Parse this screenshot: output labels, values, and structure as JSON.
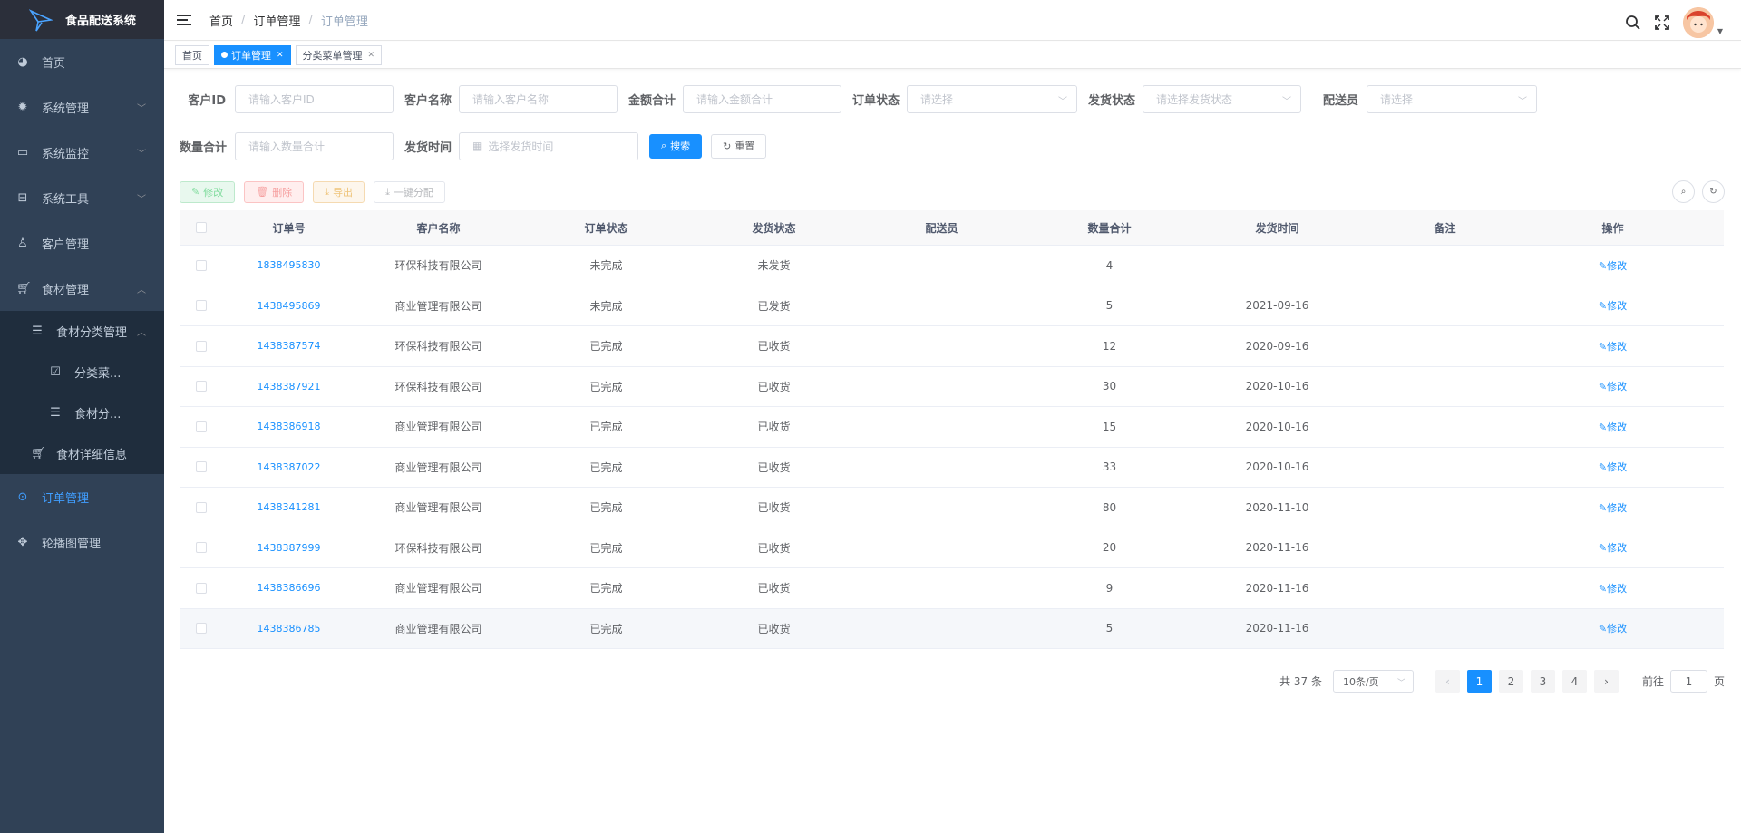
{
  "app": {
    "title": "食品配送系统"
  },
  "sidebar": {
    "items": [
      {
        "label": "首页",
        "icon": "dashboard-icon"
      },
      {
        "label": "系统管理",
        "icon": "gear-icon"
      },
      {
        "label": "系统监控",
        "icon": "monitor-icon"
      },
      {
        "label": "系统工具",
        "icon": "toolbox-icon"
      },
      {
        "label": "客户管理",
        "icon": "user-icon"
      },
      {
        "label": "食材管理",
        "icon": "cart-icon"
      },
      {
        "label": "食材分类管理",
        "icon": "list-icon"
      },
      {
        "label": "分类菜...",
        "icon": "checkbox-icon"
      },
      {
        "label": "食材分...",
        "icon": "list-icon"
      },
      {
        "label": "食材详细信息",
        "icon": "cart-icon"
      },
      {
        "label": "订单管理",
        "icon": "order-icon"
      },
      {
        "label": "轮播图管理",
        "icon": "move-icon"
      }
    ]
  },
  "breadcrumb": [
    "首页",
    "订单管理",
    "订单管理"
  ],
  "tags": [
    {
      "label": "首页"
    },
    {
      "label": "订单管理"
    },
    {
      "label": "分类菜单管理"
    }
  ],
  "search": {
    "customer_id": {
      "label": "客户ID",
      "placeholder": "请输入客户ID"
    },
    "customer_name": {
      "label": "客户名称",
      "placeholder": "请输入客户名称"
    },
    "amount": {
      "label": "金额合计",
      "placeholder": "请输入金额合计"
    },
    "order_status": {
      "label": "订单状态",
      "placeholder": "请选择"
    },
    "ship_status": {
      "label": "发货状态",
      "placeholder": "请选择发货状态"
    },
    "courier": {
      "label": "配送员",
      "placeholder": "请选择"
    },
    "quantity": {
      "label": "数量合计",
      "placeholder": "请输入数量合计"
    },
    "ship_time": {
      "label": "发货时间",
      "placeholder": "选择发货时间"
    },
    "search_btn": "搜索",
    "reset_btn": "重置"
  },
  "toolbar": {
    "edit": "修改",
    "delete": "删除",
    "export": "导出",
    "assign": "一键分配"
  },
  "table": {
    "headers": [
      "订单号",
      "客户名称",
      "订单状态",
      "发货状态",
      "配送员",
      "数量合计",
      "发货时间",
      "备注",
      "操作"
    ],
    "action_label": "修改",
    "rows": [
      {
        "order_no": "1838495830",
        "customer": "环保科技有限公司",
        "order_status": "未完成",
        "ship_status": "未发货",
        "courier": "",
        "qty": "4",
        "ship_time": "",
        "note": ""
      },
      {
        "order_no": "1438495869",
        "customer": "商业管理有限公司",
        "order_status": "未完成",
        "ship_status": "已发货",
        "courier": "",
        "qty": "5",
        "ship_time": "2021-09-16",
        "note": ""
      },
      {
        "order_no": "1438387574",
        "customer": "环保科技有限公司",
        "order_status": "已完成",
        "ship_status": "已收货",
        "courier": "",
        "qty": "12",
        "ship_time": "2020-09-16",
        "note": ""
      },
      {
        "order_no": "1438387921",
        "customer": "环保科技有限公司",
        "order_status": "已完成",
        "ship_status": "已收货",
        "courier": "",
        "qty": "30",
        "ship_time": "2020-10-16",
        "note": ""
      },
      {
        "order_no": "1438386918",
        "customer": "商业管理有限公司",
        "order_status": "已完成",
        "ship_status": "已收货",
        "courier": "",
        "qty": "15",
        "ship_time": "2020-10-16",
        "note": ""
      },
      {
        "order_no": "1438387022",
        "customer": "商业管理有限公司",
        "order_status": "已完成",
        "ship_status": "已收货",
        "courier": "",
        "qty": "33",
        "ship_time": "2020-10-16",
        "note": ""
      },
      {
        "order_no": "1438341281",
        "customer": "商业管理有限公司",
        "order_status": "已完成",
        "ship_status": "已收货",
        "courier": "",
        "qty": "80",
        "ship_time": "2020-11-10",
        "note": ""
      },
      {
        "order_no": "1438387999",
        "customer": "环保科技有限公司",
        "order_status": "已完成",
        "ship_status": "已收货",
        "courier": "",
        "qty": "20",
        "ship_time": "2020-11-16",
        "note": ""
      },
      {
        "order_no": "1438386696",
        "customer": "商业管理有限公司",
        "order_status": "已完成",
        "ship_status": "已收货",
        "courier": "",
        "qty": "9",
        "ship_time": "2020-11-16",
        "note": ""
      },
      {
        "order_no": "1438386785",
        "customer": "商业管理有限公司",
        "order_status": "已完成",
        "ship_status": "已收货",
        "courier": "",
        "qty": "5",
        "ship_time": "2020-11-16",
        "note": ""
      }
    ]
  },
  "pagination": {
    "total_text": "共 37 条",
    "page_size": "10条/页",
    "pages": [
      "1",
      "2",
      "3",
      "4"
    ],
    "current": "1",
    "goto_prefix": "前往",
    "goto_value": "1",
    "goto_suffix": "页"
  },
  "colors": {
    "sidebar_bg": "#304156",
    "accent": "#1890ff",
    "active_menu": "#409eff"
  }
}
